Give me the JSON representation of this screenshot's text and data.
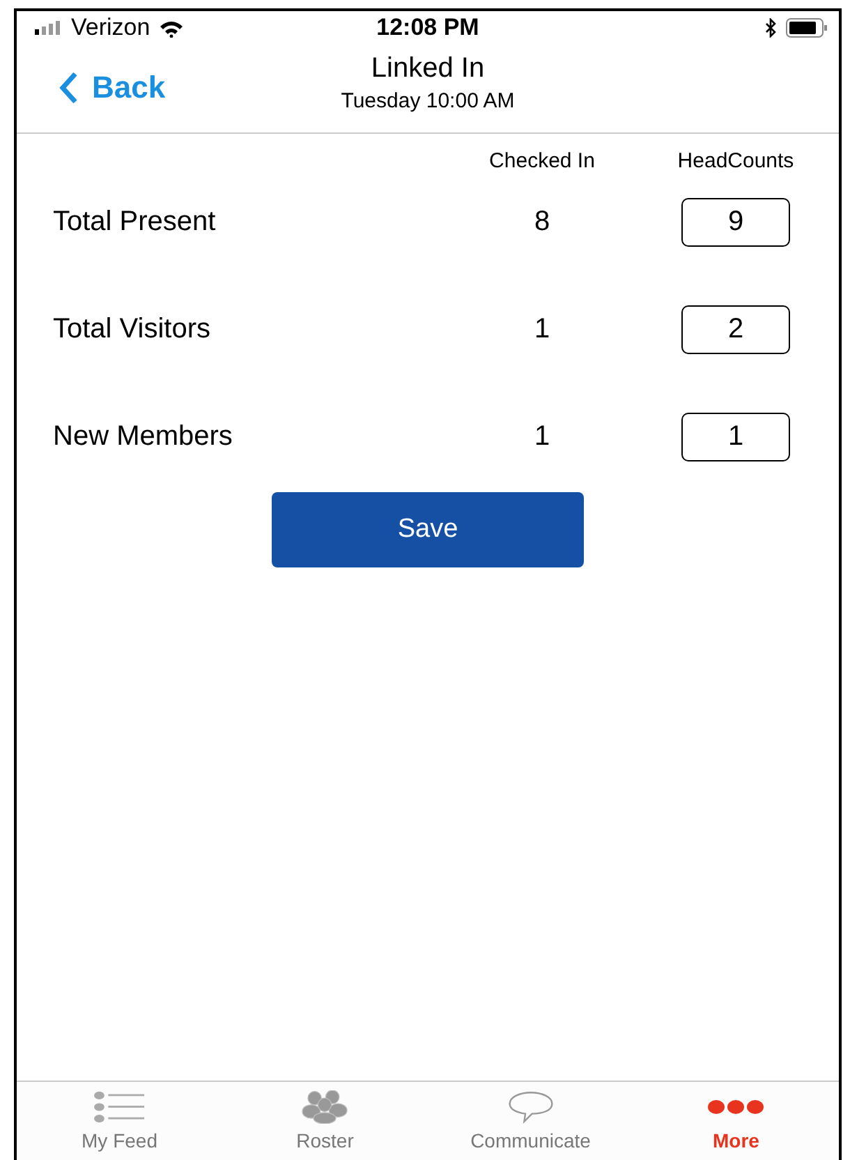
{
  "status_bar": {
    "carrier": "Verizon",
    "time": "12:08 PM"
  },
  "nav": {
    "back": "Back",
    "title": "Linked In",
    "subtitle": "Tuesday 10:00 AM"
  },
  "table": {
    "columns": [
      "Checked In",
      "HeadCounts"
    ],
    "rows": [
      {
        "label": "Total Present",
        "checked_in": "8",
        "headcount": "9"
      },
      {
        "label": "Total Visitors",
        "checked_in": "1",
        "headcount": "2"
      },
      {
        "label": "New Members",
        "checked_in": "1",
        "headcount": "1"
      }
    ]
  },
  "save_button": "Save",
  "tabs": [
    {
      "label": "My Feed",
      "kind": "list",
      "selected": false
    },
    {
      "label": "Roster",
      "kind": "people",
      "selected": false
    },
    {
      "label": "Communicate",
      "kind": "chat",
      "selected": false
    },
    {
      "label": "More",
      "kind": "more",
      "selected": true
    }
  ]
}
